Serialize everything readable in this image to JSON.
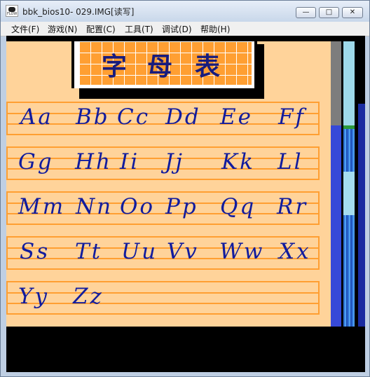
{
  "window": {
    "title": "bbk_bios10- 029.IMG[读写]",
    "buttons": {
      "minimize": "—",
      "maximize": "□",
      "close": "✕"
    }
  },
  "menu": [
    "文件(F)",
    "游戏(N)",
    "配置(C)",
    "工具(T)",
    "调试(D)",
    "帮助(H)"
  ],
  "header": {
    "chars": [
      "字",
      "母",
      "表"
    ]
  },
  "rows": [
    [
      "Aa",
      "Bb",
      "Cc",
      "Dd",
      "Ee",
      "Ff"
    ],
    [
      "Gg",
      "Hh",
      "Ii",
      "Jj",
      "Kk",
      "Ll"
    ],
    [
      "Mm",
      "Nn",
      "Oo",
      "Pp",
      "Qq",
      "Rr"
    ],
    [
      "Ss",
      "Tt",
      "Uu",
      "Vv",
      "Ww",
      "Xx"
    ],
    [
      "Yy",
      "Zz"
    ]
  ],
  "colors": {
    "page": "#ffd39a",
    "accent_orange": "#ff9f32",
    "ink_blue": "#111c9e"
  },
  "icons": [
    "app-icon",
    "minimize-icon",
    "maximize-icon",
    "close-icon"
  ]
}
